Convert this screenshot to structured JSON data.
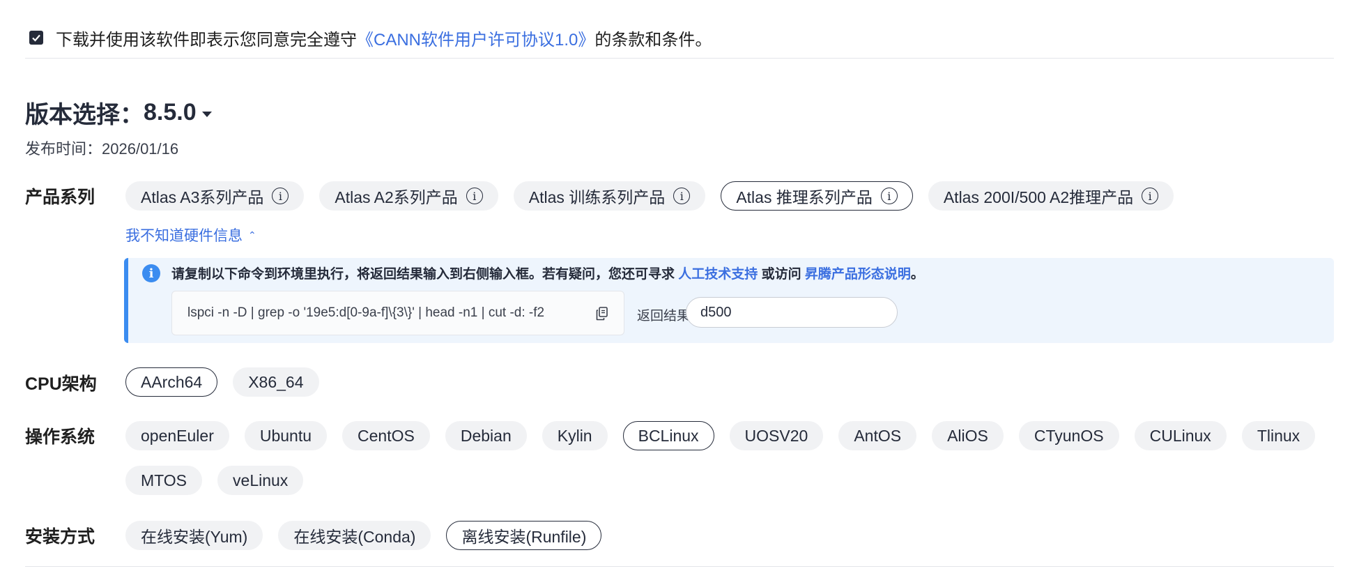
{
  "agreement": {
    "checked": true,
    "text_before": "下载并使用该软件即表示您同意完全遵守",
    "link": "《CANN软件用户许可协议1.0》",
    "text_after": "的条款和条件。"
  },
  "version": {
    "label": "版本选择：",
    "value": "8.5.0",
    "release_label": "发布时间：",
    "release_date": "2026/01/16"
  },
  "product_series": {
    "label": "产品系列",
    "options": [
      {
        "label": "Atlas A3系列产品",
        "selected": false
      },
      {
        "label": "Atlas A2系列产品",
        "selected": false
      },
      {
        "label": "Atlas 训练系列产品",
        "selected": false
      },
      {
        "label": "Atlas 推理系列产品",
        "selected": true
      },
      {
        "label": "Atlas 200I/500 A2推理产品",
        "selected": false
      }
    ],
    "unknown_hw_link": "我不知道硬件信息"
  },
  "hw_info": {
    "text_1": "请复制以下命令到环境里执行，将返回结果输入到右侧输入框。若有疑问，您还可寻求 ",
    "link_1": "人工技术支持",
    "text_2": " 或访问 ",
    "link_2": "昇腾产品形态说明",
    "text_3": "。",
    "command": "lspci -n -D | grep -o '19e5:d[0-9a-f]\\{3\\}' | head -n1 | cut -d: -f2",
    "result_label": "返回结果",
    "result_value": "d500"
  },
  "cpu_arch": {
    "label": "CPU架构",
    "options": [
      {
        "label": "AArch64",
        "selected": true
      },
      {
        "label": "X86_64",
        "selected": false
      }
    ]
  },
  "os": {
    "label": "操作系统",
    "options": [
      {
        "label": "openEuler",
        "selected": false
      },
      {
        "label": "Ubuntu",
        "selected": false
      },
      {
        "label": "CentOS",
        "selected": false
      },
      {
        "label": "Debian",
        "selected": false
      },
      {
        "label": "Kylin",
        "selected": false
      },
      {
        "label": "BCLinux",
        "selected": true
      },
      {
        "label": "UOSV20",
        "selected": false
      },
      {
        "label": "AntOS",
        "selected": false
      },
      {
        "label": "AliOS",
        "selected": false
      },
      {
        "label": "CTyunOS",
        "selected": false
      },
      {
        "label": "CULinux",
        "selected": false
      },
      {
        "label": "Tlinux",
        "selected": false
      },
      {
        "label": "MTOS",
        "selected": false
      },
      {
        "label": "veLinux",
        "selected": false
      }
    ]
  },
  "install_method": {
    "label": "安装方式",
    "options": [
      {
        "label": "在线安装(Yum)",
        "selected": false
      },
      {
        "label": "在线安装(Conda)",
        "selected": false
      },
      {
        "label": "离线安装(Runfile)",
        "selected": true
      }
    ]
  }
}
